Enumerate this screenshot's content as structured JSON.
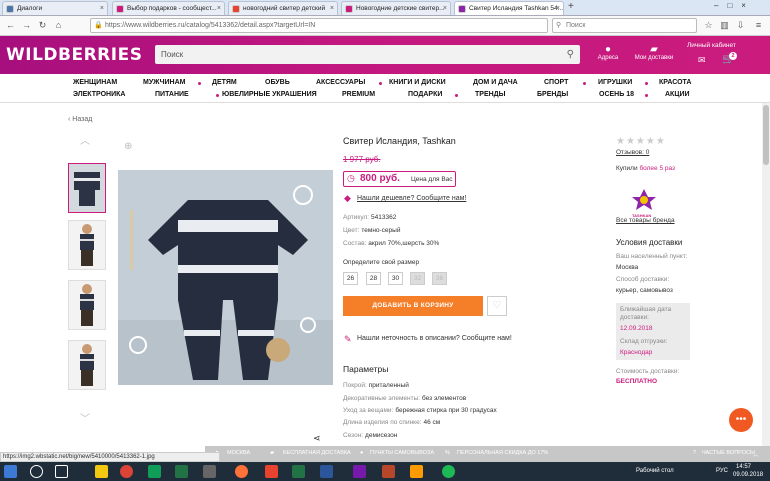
{
  "browser": {
    "tabs": [
      {
        "label": "Диалоги",
        "color": "#4a76a8"
      },
      {
        "label": "Выбор подарков - сообщест...",
        "color": "#cb1c7e"
      },
      {
        "label": "новогодний свитер детский",
        "color": "#e8432e"
      },
      {
        "label": "Новогодние детские свитер...",
        "color": "#cb1c7e"
      },
      {
        "label": "Свитер Исландия Tashkan 54...",
        "color": "#8e24aa"
      }
    ],
    "url": "https://www.wildberries.ru/catalog/5413362/detail.aspx?targetUrl=IN",
    "search_placeholder": "Поиск"
  },
  "header": {
    "logo": "WILDBERRIES",
    "search_placeholder": "Поиск",
    "addresses": "Адреса",
    "deliveries": "Мои доставки",
    "cabinet": "Личный кабинет",
    "cart_count": "2"
  },
  "menu": {
    "row1": [
      "ЖЕНЩИНАМ",
      "МУЖЧИНАМ",
      "ДЕТЯМ",
      "ОБУВЬ",
      "АКСЕССУАРЫ",
      "КНИГИ И ДИСКИ",
      "ДОМ И ДАЧА",
      "СПОРТ",
      "ИГРУШКИ",
      "КРАСОТА"
    ],
    "row2": [
      "ЭЛЕКТРОНИКА",
      "ПИТАНИЕ",
      "ЮВЕЛИРНЫЕ УКРАШЕНИЯ",
      "PREMIUM",
      "ПОДАРКИ",
      "ТРЕНДЫ",
      "БРЕНДЫ",
      "ОСЕНЬ 18",
      "АКЦИИ"
    ]
  },
  "product": {
    "back": "Назад",
    "title": "Свитер Исландия, Tashkan",
    "old_price": "1 977 руб.",
    "price": "800 руб.",
    "price_note": "Цена для Вас",
    "cheaper_link": "Нашли дешевле? Сообщите нам!",
    "article_label": "Артикул:",
    "article": "5413362",
    "color_label": "Цвет:",
    "color": "темно-серый",
    "composition_label": "Состав:",
    "composition": "акрил 70%,шерсть 30%",
    "size_prompt": "Определите свой размер",
    "sizes": [
      "26",
      "28",
      "30",
      "32",
      "36"
    ],
    "add_to_cart": "ДОБАВИТЬ В КОРЗИНУ",
    "inaccuracy_link": "Нашли неточность в описании? Сообщите нам!",
    "params_title": "Параметры",
    "params": [
      {
        "label": "Покрой:",
        "value": "приталенный"
      },
      {
        "label": "Декоративные элементы:",
        "value": "без элементов"
      },
      {
        "label": "Уход за вещами:",
        "value": "бережная стирка при 30 градусах"
      },
      {
        "label": "Длина изделия по спинке:",
        "value": "46 см"
      },
      {
        "label": "Сезон:",
        "value": "демисезон"
      }
    ]
  },
  "sidebar": {
    "rating_stars": 0,
    "reviews": "Отзывов: 0",
    "bought_label": "Купили",
    "bought_value": "более 5 раз",
    "brand_logo": "TASHKAN",
    "brand_link": "Все товары бренда",
    "delivery_title": "Условия доставки",
    "city_label": "Ваш населенный пункт:",
    "city": "Москва",
    "method_label": "Способ доставки:",
    "method": "курьер, самовывоз",
    "nearest_label": "Ближайшая дата доставки:",
    "nearest_date": "12.09.2018",
    "warehouse_label": "Склад отгрузки:",
    "warehouse": "Краснодар",
    "cost_label": "Стоимость доставки:",
    "cost": "БЕСПЛАТНО"
  },
  "status_url": "https://img2.wbstatic.net/big/new/5410000/5413362-1.jpg",
  "bottom_bar": {
    "city": "МОСКВА",
    "free_delivery": "БЕСПЛАТНАЯ ДОСТАВКА",
    "pickup": "ПУНКТЫ САМОВЫВОЗА",
    "discount": "ПЕРСОНАЛЬНАЯ СКИДКА ДО 17%",
    "faq": "ЧАСТЫЕ ВОПРОСЫ"
  },
  "taskbar": {
    "desktop": "Рабочий стол",
    "lang": "РУС",
    "time": "14:57",
    "date": "09.09.2018"
  }
}
